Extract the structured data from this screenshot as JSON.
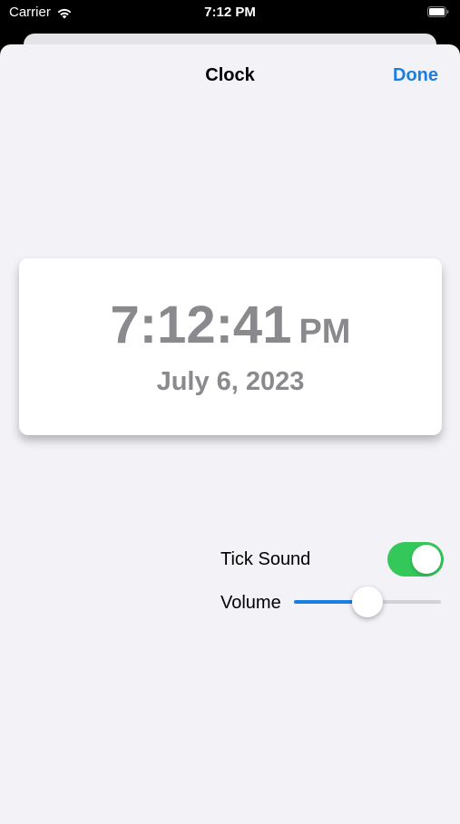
{
  "status_bar": {
    "carrier": "Carrier",
    "time": "7:12 PM",
    "icons": [
      "wifi-icon",
      "battery-icon"
    ]
  },
  "nav": {
    "title": "Clock",
    "done_label": "Done"
  },
  "clock": {
    "time": "7:12:41",
    "ampm": "PM",
    "date": "July 6, 2023"
  },
  "settings": {
    "tick_sound_label": "Tick Sound",
    "tick_sound_on": true,
    "volume_label": "Volume",
    "volume_level": 0.5
  },
  "colors": {
    "accent": "#1a7fe0",
    "toggle_on": "#34c759",
    "clock_text": "#8a8a8e",
    "sheet_background": "#f2f2f7"
  }
}
